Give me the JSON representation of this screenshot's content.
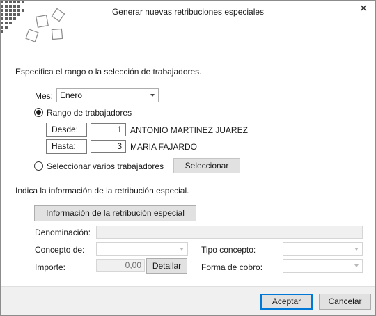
{
  "window": {
    "title": "Generar nuevas retribuciones especiales",
    "close_label": "✕"
  },
  "range_section": {
    "heading": "Especifica el rango o la selección de trabajadores.",
    "mes_label": "Mes:",
    "mes_value": "Enero",
    "rango_label": "Rango de trabajadores",
    "rango_selected": true,
    "desde_label": "Desde:",
    "desde_value": "1",
    "desde_name": "ANTONIO MARTINEZ JUAREZ",
    "hasta_label": "Hasta:",
    "hasta_value": "3",
    "hasta_name": "MARIA FAJARDO",
    "varios_label": "Seleccionar varios trabajadores",
    "varios_selected": false,
    "seleccionar_button": "Seleccionar"
  },
  "retribution_section": {
    "heading": "Indica la información de la retribución especial.",
    "info_button": "Información de la retribución especial",
    "denominacion_label": "Denominación:",
    "denominacion_value": "",
    "concepto_label": "Concepto de:",
    "concepto_value": "",
    "tipo_concepto_label": "Tipo concepto:",
    "tipo_concepto_value": "",
    "importe_label": "Importe:",
    "importe_value": "0,00",
    "detallar_button": "Detallar",
    "forma_cobro_label": "Forma de cobro:",
    "forma_cobro_value": ""
  },
  "footer": {
    "accept_button": "Aceptar",
    "cancel_button": "Cancelar"
  },
  "colors": {
    "accent": "#0078d7",
    "footer_bg": "#f0f0f0",
    "button_bg": "#e1e1e1",
    "logo_squares": "#5f5f5f"
  },
  "icons": [
    "app-logo-icon",
    "close-icon",
    "chevron-down-icon"
  ]
}
